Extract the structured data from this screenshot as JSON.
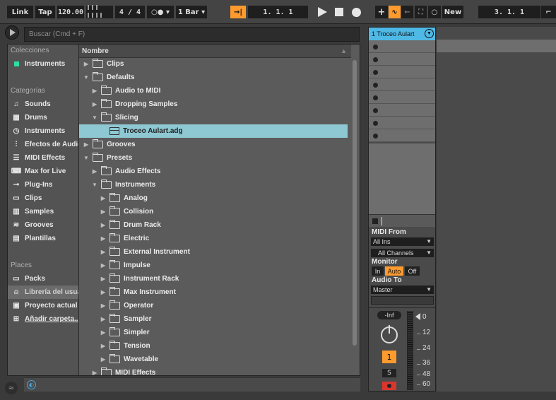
{
  "transport": {
    "link": "Link",
    "tap": "Tap",
    "tempo": "120.00",
    "signature_num": "4",
    "signature_sep": "/",
    "signature_den": "4",
    "metronome": "○●",
    "quantize": "1 Bar",
    "position": "1.  1.  1",
    "loop_start": "3.  1.  1",
    "new_label": "New",
    "accent_color": "#ff9a2e"
  },
  "browser": {
    "search_placeholder": "Buscar (Cmd + F)",
    "collections_head": "Colecciones",
    "collection_item": "Instruments",
    "collection_color": "#2ee0a0",
    "categories_head": "Categorías",
    "categories": [
      {
        "label": "Sounds",
        "icon": "sounds-icon"
      },
      {
        "label": "Drums",
        "icon": "drums-icon"
      },
      {
        "label": "Instruments",
        "icon": "instruments-icon"
      },
      {
        "label": "Efectos de Audio",
        "icon": "audio-effects-icon"
      },
      {
        "label": "MIDI Effects",
        "icon": "midi-effects-icon"
      },
      {
        "label": "Max for Live",
        "icon": "max-for-live-icon"
      },
      {
        "label": "Plug-Ins",
        "icon": "plugins-icon"
      },
      {
        "label": "Clips",
        "icon": "clips-icon"
      },
      {
        "label": "Samples",
        "icon": "samples-icon"
      },
      {
        "label": "Grooves",
        "icon": "grooves-icon"
      },
      {
        "label": "Plantillas",
        "icon": "templates-icon"
      }
    ],
    "places_head": "Places",
    "places": [
      {
        "label": "Packs",
        "icon": "packs-icon"
      },
      {
        "label": "Librería del usuario",
        "icon": "user-library-icon"
      },
      {
        "label": "Proyecto actual",
        "icon": "current-project-icon"
      },
      {
        "label": "Añadir carpeta...",
        "icon": "add-folder-icon"
      }
    ],
    "column_header": "Nombre",
    "tree": [
      {
        "label": "Clips",
        "depth": 0,
        "open": false
      },
      {
        "label": "Defaults",
        "depth": 0,
        "open": true
      },
      {
        "label": "Audio to MIDI",
        "depth": 1,
        "open": false
      },
      {
        "label": "Dropping Samples",
        "depth": 1,
        "open": false
      },
      {
        "label": "Slicing",
        "depth": 1,
        "open": true
      },
      {
        "label": "Troceo Aulart.adg",
        "depth": 2,
        "file": true,
        "selected": true
      },
      {
        "label": "Grooves",
        "depth": 0,
        "open": false
      },
      {
        "label": "Presets",
        "depth": 0,
        "open": true
      },
      {
        "label": "Audio Effects",
        "depth": 1,
        "open": false
      },
      {
        "label": "Instruments",
        "depth": 1,
        "open": true
      },
      {
        "label": "Analog",
        "depth": 2,
        "open": false
      },
      {
        "label": "Collision",
        "depth": 2,
        "open": false
      },
      {
        "label": "Drum Rack",
        "depth": 2,
        "open": false
      },
      {
        "label": "Electric",
        "depth": 2,
        "open": false
      },
      {
        "label": "External Instrument",
        "depth": 2,
        "open": false
      },
      {
        "label": "Impulse",
        "depth": 2,
        "open": false
      },
      {
        "label": "Instrument Rack",
        "depth": 2,
        "open": false
      },
      {
        "label": "Max Instrument",
        "depth": 2,
        "open": false
      },
      {
        "label": "Operator",
        "depth": 2,
        "open": false
      },
      {
        "label": "Sampler",
        "depth": 2,
        "open": false
      },
      {
        "label": "Simpler",
        "depth": 2,
        "open": false
      },
      {
        "label": "Tension",
        "depth": 2,
        "open": false
      },
      {
        "label": "Wavetable",
        "depth": 2,
        "open": false
      },
      {
        "label": "MIDI Effects",
        "depth": 1,
        "open": false
      }
    ],
    "selected_color": "#8ec8d2"
  },
  "track": {
    "name": "1 Troceo Aulart",
    "color": "#4fb9e6",
    "midi_from_label": "MIDI From",
    "midi_from_value": "All Ins",
    "channel_value": "All Channels",
    "monitor_label": "Monitor",
    "monitor_in": "In",
    "monitor_auto": "Auto",
    "monitor_off": "Off",
    "audio_to_label": "Audio To",
    "audio_to_value": "Master",
    "volume_readout": "-Inf",
    "track_number": "1",
    "solo_label": "S",
    "db_scale": [
      "0",
      "12",
      "24",
      "36",
      "48",
      "60"
    ]
  }
}
